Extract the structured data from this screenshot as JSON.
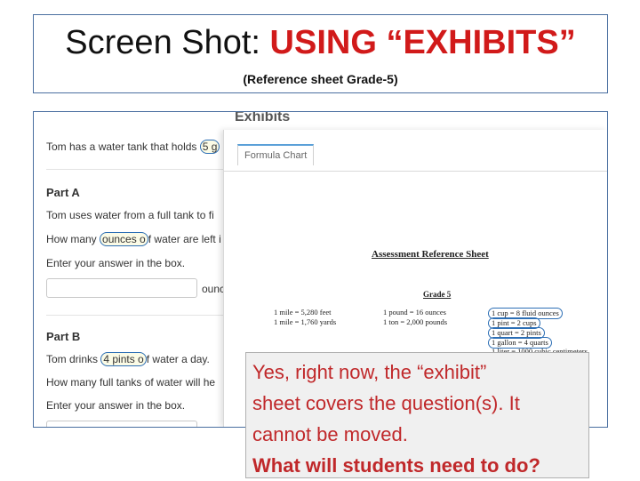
{
  "slide": {
    "title_prefix": "Screen Shot: ",
    "title_accent": "USING “EXHIBITS”",
    "subtitle": "(Reference sheet Grade-5)"
  },
  "question_pane": {
    "intro_before": "Tom has a water tank that holds ",
    "intro_highlight": "5 g",
    "part_a_label": "Part A",
    "part_a_line1": "Tom uses water from a full tank to fi",
    "part_a_line2_before": "How many ",
    "part_a_line2_highlight": "ounces o",
    "part_a_line2_after": "f water are left i",
    "part_a_line3": "Enter your answer in the box.",
    "part_a_unit": "ounc",
    "part_b_label": "Part B",
    "part_b_line1_before": "Tom drinks ",
    "part_b_line1_highlight": "4 pints o",
    "part_b_line1_after": "f water a day.",
    "part_b_line2": "How many full tanks of water will he",
    "part_b_line3": "Enter your answer in the box."
  },
  "exhibits": {
    "title": "Exhibits",
    "tab_label": "Formula Chart",
    "sheet_title": "Assessment Reference Sheet",
    "grade_label": "Grade 5",
    "col1": [
      "1 mile = 5,280 feet",
      "1 mile = 1,760 yards"
    ],
    "col2": [
      "1 pound = 16 ounces",
      "1 ton = 2,000 pounds"
    ],
    "col3": [
      "1 cup = 8 fluid ounces",
      "1 pint = 2 cups",
      "1 quart = 2 pints",
      "1 gallon = 4 quarts",
      "1 liter = 1000 cubic centimeters"
    ]
  },
  "overlay": {
    "line1": "Yes, right now, the “exhibit”",
    "line2": "sheet covers the question(s). It",
    "line3": "cannot be moved.",
    "line4": "What will students need to do?"
  }
}
